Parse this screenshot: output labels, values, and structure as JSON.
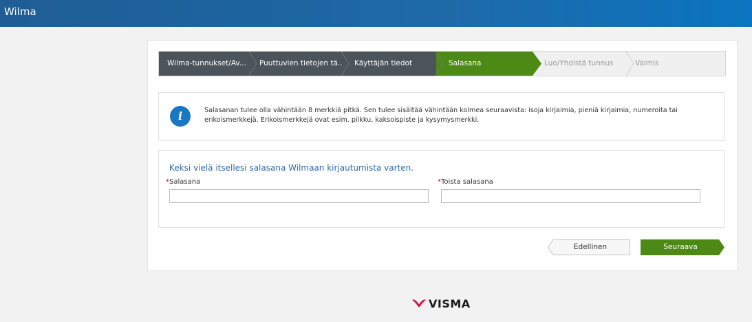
{
  "app": {
    "title": "Wilma"
  },
  "wizard": {
    "steps": [
      {
        "label": "Wilma-tunnukset/Av...",
        "state": "done"
      },
      {
        "label": "Puuttuvien tietojen tä...",
        "state": "done"
      },
      {
        "label": "Käyttäjän tiedot",
        "state": "done"
      },
      {
        "label": "Salasana",
        "state": "active"
      },
      {
        "label": "Luo/Yhdistä tunnus",
        "state": "todo"
      },
      {
        "label": "Valmis",
        "state": "todo"
      }
    ]
  },
  "info": {
    "icon": "info-icon",
    "text": "Salasanan tulee olla vähintään 8 merkkiä pitkä. Sen tulee sisältää vähintään kolmea seuraavista: isoja kirjaimia, pieniä kirjaimia, numeroita tai erikoismerkkejä. Erikoismerkkejä ovat esim. pilkku, kaksoispiste ja kysymysmerkki."
  },
  "form": {
    "heading": "Keksi vielä itsellesi salasana Wilmaan kirjautumista varten.",
    "required_mark": "*",
    "password_label": "Salasana",
    "password_value": "",
    "repeat_label": "Toista salasana",
    "repeat_value": ""
  },
  "buttons": {
    "previous": "Edellinen",
    "next": "Seuraava"
  },
  "footer": {
    "logo_text": "VISMA"
  },
  "colors": {
    "header": "#1e6aa9",
    "step_done": "#4b545b",
    "step_active": "#4d8a15",
    "info_icon": "#1a78c2",
    "next_button": "#4d8a15",
    "logo_red": "#d2184b"
  }
}
